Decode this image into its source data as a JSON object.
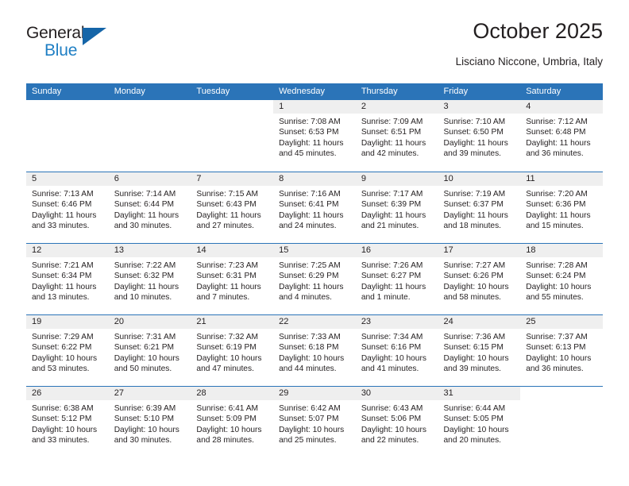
{
  "brand": {
    "word1": "General",
    "word2": "Blue",
    "triangle_color": "#1565a8",
    "blue_color": "#1f7fc4"
  },
  "header": {
    "title": "October 2025",
    "subtitle": "Lisciano Niccone, Umbria, Italy"
  },
  "theme": {
    "header_bg": "#2b74b8",
    "header_text": "#ffffff",
    "daynum_bg": "#efefef",
    "body_text": "#231f20",
    "week_divider": "#2b74b8"
  },
  "weekdays": [
    "Sunday",
    "Monday",
    "Tuesday",
    "Wednesday",
    "Thursday",
    "Friday",
    "Saturday"
  ],
  "weeks": [
    [
      {
        "day": "",
        "blank": true
      },
      {
        "day": "",
        "blank": true
      },
      {
        "day": "",
        "blank": true
      },
      {
        "day": "1",
        "sunrise": "Sunrise: 7:08 AM",
        "sunset": "Sunset: 6:53 PM",
        "daylight": "Daylight: 11 hours and 45 minutes."
      },
      {
        "day": "2",
        "sunrise": "Sunrise: 7:09 AM",
        "sunset": "Sunset: 6:51 PM",
        "daylight": "Daylight: 11 hours and 42 minutes."
      },
      {
        "day": "3",
        "sunrise": "Sunrise: 7:10 AM",
        "sunset": "Sunset: 6:50 PM",
        "daylight": "Daylight: 11 hours and 39 minutes."
      },
      {
        "day": "4",
        "sunrise": "Sunrise: 7:12 AM",
        "sunset": "Sunset: 6:48 PM",
        "daylight": "Daylight: 11 hours and 36 minutes."
      }
    ],
    [
      {
        "day": "5",
        "sunrise": "Sunrise: 7:13 AM",
        "sunset": "Sunset: 6:46 PM",
        "daylight": "Daylight: 11 hours and 33 minutes."
      },
      {
        "day": "6",
        "sunrise": "Sunrise: 7:14 AM",
        "sunset": "Sunset: 6:44 PM",
        "daylight": "Daylight: 11 hours and 30 minutes."
      },
      {
        "day": "7",
        "sunrise": "Sunrise: 7:15 AM",
        "sunset": "Sunset: 6:43 PM",
        "daylight": "Daylight: 11 hours and 27 minutes."
      },
      {
        "day": "8",
        "sunrise": "Sunrise: 7:16 AM",
        "sunset": "Sunset: 6:41 PM",
        "daylight": "Daylight: 11 hours and 24 minutes."
      },
      {
        "day": "9",
        "sunrise": "Sunrise: 7:17 AM",
        "sunset": "Sunset: 6:39 PM",
        "daylight": "Daylight: 11 hours and 21 minutes."
      },
      {
        "day": "10",
        "sunrise": "Sunrise: 7:19 AM",
        "sunset": "Sunset: 6:37 PM",
        "daylight": "Daylight: 11 hours and 18 minutes."
      },
      {
        "day": "11",
        "sunrise": "Sunrise: 7:20 AM",
        "sunset": "Sunset: 6:36 PM",
        "daylight": "Daylight: 11 hours and 15 minutes."
      }
    ],
    [
      {
        "day": "12",
        "sunrise": "Sunrise: 7:21 AM",
        "sunset": "Sunset: 6:34 PM",
        "daylight": "Daylight: 11 hours and 13 minutes."
      },
      {
        "day": "13",
        "sunrise": "Sunrise: 7:22 AM",
        "sunset": "Sunset: 6:32 PM",
        "daylight": "Daylight: 11 hours and 10 minutes."
      },
      {
        "day": "14",
        "sunrise": "Sunrise: 7:23 AM",
        "sunset": "Sunset: 6:31 PM",
        "daylight": "Daylight: 11 hours and 7 minutes."
      },
      {
        "day": "15",
        "sunrise": "Sunrise: 7:25 AM",
        "sunset": "Sunset: 6:29 PM",
        "daylight": "Daylight: 11 hours and 4 minutes."
      },
      {
        "day": "16",
        "sunrise": "Sunrise: 7:26 AM",
        "sunset": "Sunset: 6:27 PM",
        "daylight": "Daylight: 11 hours and 1 minute."
      },
      {
        "day": "17",
        "sunrise": "Sunrise: 7:27 AM",
        "sunset": "Sunset: 6:26 PM",
        "daylight": "Daylight: 10 hours and 58 minutes."
      },
      {
        "day": "18",
        "sunrise": "Sunrise: 7:28 AM",
        "sunset": "Sunset: 6:24 PM",
        "daylight": "Daylight: 10 hours and 55 minutes."
      }
    ],
    [
      {
        "day": "19",
        "sunrise": "Sunrise: 7:29 AM",
        "sunset": "Sunset: 6:22 PM",
        "daylight": "Daylight: 10 hours and 53 minutes."
      },
      {
        "day": "20",
        "sunrise": "Sunrise: 7:31 AM",
        "sunset": "Sunset: 6:21 PM",
        "daylight": "Daylight: 10 hours and 50 minutes."
      },
      {
        "day": "21",
        "sunrise": "Sunrise: 7:32 AM",
        "sunset": "Sunset: 6:19 PM",
        "daylight": "Daylight: 10 hours and 47 minutes."
      },
      {
        "day": "22",
        "sunrise": "Sunrise: 7:33 AM",
        "sunset": "Sunset: 6:18 PM",
        "daylight": "Daylight: 10 hours and 44 minutes."
      },
      {
        "day": "23",
        "sunrise": "Sunrise: 7:34 AM",
        "sunset": "Sunset: 6:16 PM",
        "daylight": "Daylight: 10 hours and 41 minutes."
      },
      {
        "day": "24",
        "sunrise": "Sunrise: 7:36 AM",
        "sunset": "Sunset: 6:15 PM",
        "daylight": "Daylight: 10 hours and 39 minutes."
      },
      {
        "day": "25",
        "sunrise": "Sunrise: 7:37 AM",
        "sunset": "Sunset: 6:13 PM",
        "daylight": "Daylight: 10 hours and 36 minutes."
      }
    ],
    [
      {
        "day": "26",
        "sunrise": "Sunrise: 6:38 AM",
        "sunset": "Sunset: 5:12 PM",
        "daylight": "Daylight: 10 hours and 33 minutes."
      },
      {
        "day": "27",
        "sunrise": "Sunrise: 6:39 AM",
        "sunset": "Sunset: 5:10 PM",
        "daylight": "Daylight: 10 hours and 30 minutes."
      },
      {
        "day": "28",
        "sunrise": "Sunrise: 6:41 AM",
        "sunset": "Sunset: 5:09 PM",
        "daylight": "Daylight: 10 hours and 28 minutes."
      },
      {
        "day": "29",
        "sunrise": "Sunrise: 6:42 AM",
        "sunset": "Sunset: 5:07 PM",
        "daylight": "Daylight: 10 hours and 25 minutes."
      },
      {
        "day": "30",
        "sunrise": "Sunrise: 6:43 AM",
        "sunset": "Sunset: 5:06 PM",
        "daylight": "Daylight: 10 hours and 22 minutes."
      },
      {
        "day": "31",
        "sunrise": "Sunrise: 6:44 AM",
        "sunset": "Sunset: 5:05 PM",
        "daylight": "Daylight: 10 hours and 20 minutes."
      },
      {
        "day": "",
        "blank": true
      }
    ]
  ]
}
